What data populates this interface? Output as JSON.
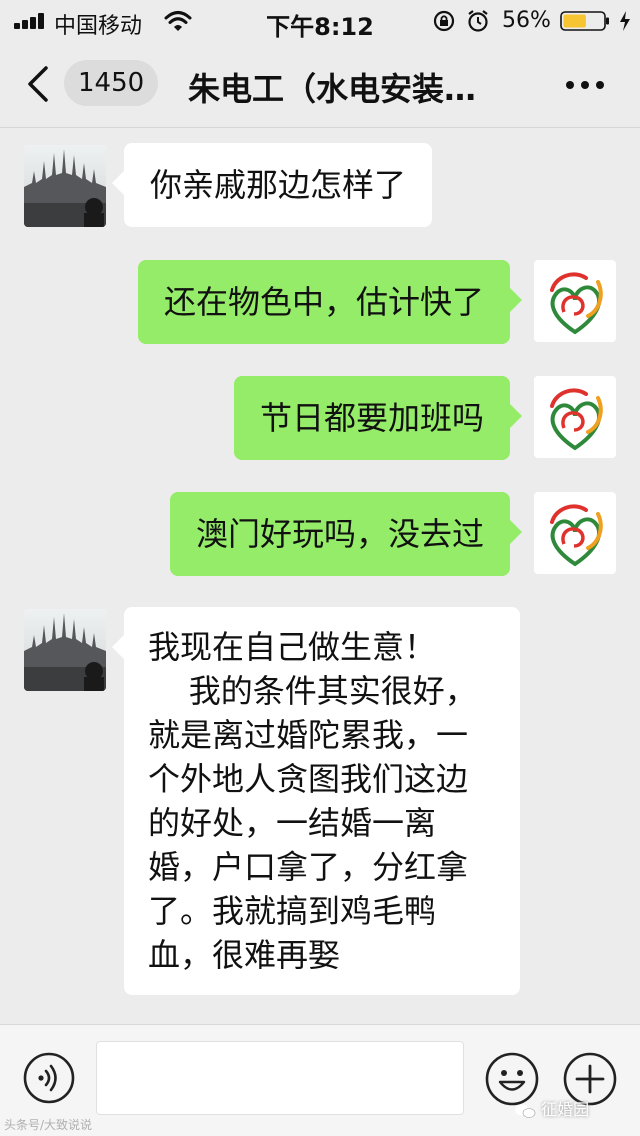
{
  "status_bar": {
    "carrier": "中国移动",
    "time": "下午8:12",
    "battery_percent": "56%",
    "battery_level": 0.56,
    "icons": [
      "signal-icon",
      "wifi-icon",
      "rotation-lock-icon",
      "alarm-icon",
      "battery-icon",
      "charging-icon"
    ]
  },
  "nav": {
    "unread_count": "1450",
    "title": "朱电工（水电安装…",
    "back_icon": "chevron-left-icon",
    "more_icon": "more-dots-icon"
  },
  "messages": [
    {
      "side": "left",
      "sender": "contact",
      "text": "你亲戚那边怎样了"
    },
    {
      "side": "right",
      "sender": "me",
      "text": "还在物色中，估计快了"
    },
    {
      "side": "right",
      "sender": "me",
      "text": "节日都要加班吗"
    },
    {
      "side": "right",
      "sender": "me",
      "text": "澳门好玩吗，没去过"
    },
    {
      "side": "left",
      "sender": "contact",
      "lines": [
        "我现在自己做生意！",
        "    我的条件其实很好，",
        "就是离过婚陀累我，一",
        "个外地人贪图我们这边",
        "的好处，一结婚一离",
        "婚，户口拿了，分红拿",
        "了。我就搞到鸡毛鸭",
        "血，很难再娶"
      ]
    }
  ],
  "input_bar": {
    "voice_icon": "voice-icon",
    "text_value": "",
    "emoji_icon": "emoji-icon",
    "plus_icon": "plus-icon"
  },
  "watermarks": {
    "left": "头条号/大致说说",
    "right": "征婚园"
  },
  "colors": {
    "background": "#ececec",
    "my_bubble": "#95ec69",
    "their_bubble": "#ffffff",
    "battery_fill": "#f7c531"
  }
}
